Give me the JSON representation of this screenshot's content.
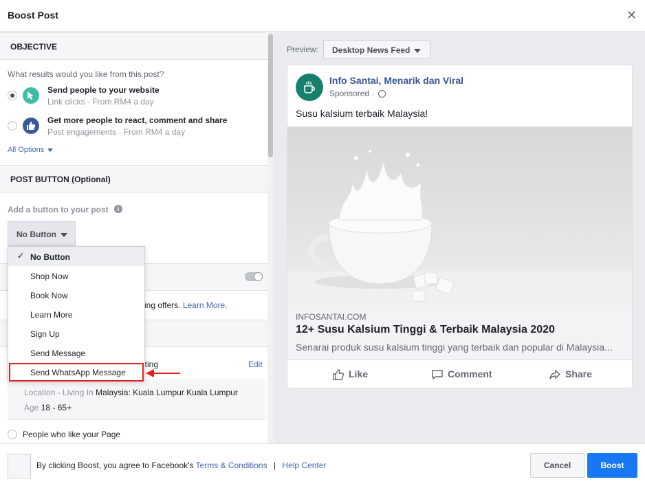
{
  "header": {
    "title": "Boost Post",
    "close": "✕"
  },
  "objective": {
    "heading": "OBJECTIVE",
    "question": "What results would you like from this post?",
    "options": [
      {
        "title": "Send people to your website",
        "subtitle": "Link clicks · From RM4 a day",
        "selected": true,
        "icon": "cursor-icon",
        "color": "#3ebda5"
      },
      {
        "title": "Get more people to react, comment and share",
        "subtitle": "Post engagements · From RM4 a day",
        "selected": false,
        "icon": "thumbs-up-icon",
        "color": "#3b5998"
      }
    ],
    "all_options": "All Options"
  },
  "post_button": {
    "heading": "POST BUTTON (Optional)",
    "label": "Add a button to your post",
    "selected": "No Button",
    "options": [
      "No Button",
      "Shop Now",
      "Book Now",
      "Learn More",
      "Sign Up",
      "Send Message",
      "Send WhatsApp Message"
    ],
    "highlighted": "Send WhatsApp Message"
  },
  "hidden_partial": {
    "offers_text": "sing offers.",
    "learn_more": "Learn More.",
    "targeting_text": "eting",
    "edit": "Edit"
  },
  "audience": {
    "location_label": "Location - Living In",
    "location_value": "Malaysia: Kuala Lumpur Kuala Lumpur",
    "age_label": "Age",
    "age_value": "18 - 65+",
    "people_option": "People who like your Page"
  },
  "preview": {
    "label": "Preview:",
    "placement": "Desktop News Feed",
    "page_name": "Info Santai, Menarik dan Viral",
    "sponsored": "Sponsored ·",
    "post_text": "Susu kalsium terbaik Malaysia!",
    "link_domain": "INFOSANTAI.COM",
    "link_title": "12+ Susu Kalsium Tinggi & Terbaik Malaysia 2020",
    "link_desc": "Senarai produk susu kalsium tinggi yang terbaik dan popular di Malaysia...",
    "actions": {
      "like": "Like",
      "comment": "Comment",
      "share": "Share"
    }
  },
  "footer": {
    "agree_prefix": "By clicking Boost, you agree to Facebook's",
    "terms": "Terms & Conditions",
    "separator": "|",
    "help": "Help Center",
    "cancel": "Cancel",
    "boost": "Boost"
  },
  "colors": {
    "accent": "#1877f2",
    "link": "#4267b2",
    "highlight": "#e02020",
    "page_avatar": "#17806d"
  }
}
